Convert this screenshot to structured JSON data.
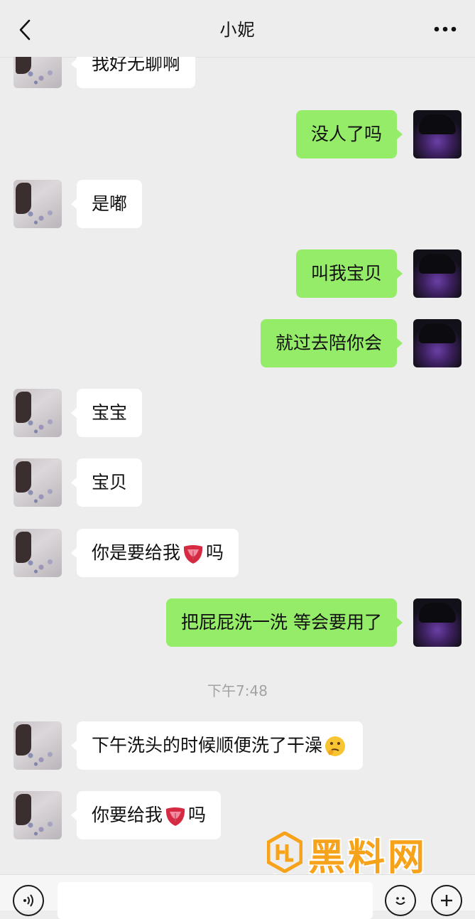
{
  "header": {
    "title": "小妮",
    "back_icon": "chevron-left-icon",
    "more_icon": "more-dots-icon"
  },
  "messages": [
    {
      "from": "her",
      "text": "我好无聊啊"
    },
    {
      "from": "me",
      "text": "没人了吗"
    },
    {
      "from": "her",
      "text": "是嘟"
    },
    {
      "from": "me",
      "text": "叫我宝贝"
    },
    {
      "from": "me",
      "text": "就过去陪你会"
    },
    {
      "from": "her",
      "text": "宝宝"
    },
    {
      "from": "her",
      "text": "宝贝"
    },
    {
      "from": "her",
      "text_before": "你是要给我",
      "emoji": "tongue-emoji",
      "text_after": "吗"
    },
    {
      "from": "me",
      "text": "把屁屁洗一洗 等会要用了"
    },
    {
      "from": "her",
      "text_before": "下午洗头的时候顺便洗了干澡",
      "emoji": "thinking-emoji",
      "text_after": ""
    },
    {
      "from": "her",
      "text_before": "你要给我",
      "emoji": "tongue-emoji",
      "text_after": "吗"
    }
  ],
  "timestamp": "下午7:48",
  "input": {
    "value": "",
    "voice_icon": "voice-icon",
    "emoji_icon": "smiley-icon",
    "plus_icon": "plus-icon"
  },
  "watermark": {
    "name": "黑料网",
    "url": "https://hlwe7.com"
  },
  "colors": {
    "background": "#ededed",
    "outgoing_bubble": "#95ec69",
    "incoming_bubble": "#ffffff",
    "timestamp": "#a3a3a3",
    "watermark": "#f7a21b"
  }
}
